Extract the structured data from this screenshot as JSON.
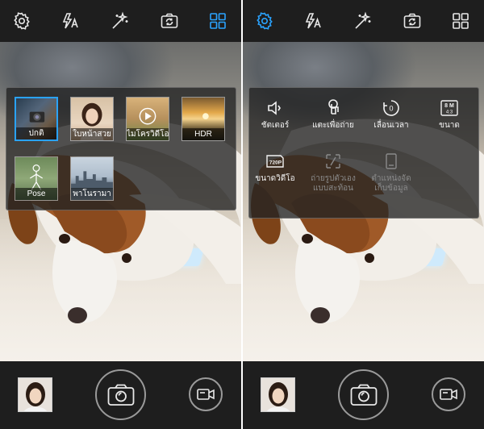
{
  "colors": {
    "accent": "#2aa3ff",
    "icon": "#e8e8e8",
    "disabled": "#8a8a8a"
  },
  "top_icons": [
    "settings-gear-icon",
    "flash-auto-icon",
    "magic-wand-icon",
    "switch-camera-icon",
    "modes-grid-icon"
  ],
  "left_panel": {
    "modes": [
      {
        "label": "ปกติ",
        "icon": "normal-mode-icon",
        "selected": true
      },
      {
        "label": "ใบหน้าสวย",
        "icon": "beauty-face-icon",
        "selected": false
      },
      {
        "label": "ไมโครวิดีโอ",
        "icon": "micro-video-icon",
        "selected": false
      },
      {
        "label": "HDR",
        "icon": "hdr-icon",
        "selected": false
      },
      {
        "label": "Pose",
        "icon": "pose-icon",
        "selected": false
      },
      {
        "label": "พาโนรามา",
        "icon": "panorama-icon",
        "selected": false
      }
    ]
  },
  "right_panel": {
    "settings": [
      {
        "label": "ชัตเตอร์",
        "icon": "shutter-sound-icon",
        "enabled": true
      },
      {
        "label": "แตะเพื่อถ่าย",
        "icon": "tap-to-shoot-icon",
        "enabled": true
      },
      {
        "label": "เลื่อนเวลา",
        "icon": "timer-icon",
        "enabled": true
      },
      {
        "label": "ขนาด",
        "icon": "image-size-icon",
        "enabled": true
      },
      {
        "label": "ขนาดวิดีโอ",
        "icon": "video-size-icon",
        "enabled": true
      },
      {
        "label": "ถ่ายรูปตัวเอง แบบสะท้อน",
        "icon": "mirror-selfie-icon",
        "enabled": false
      },
      {
        "label": "ตำแหน่งจัด เก็บข้อมูล",
        "icon": "storage-location-icon",
        "enabled": false
      }
    ],
    "image_size_badge": "8 M",
    "image_ratio_badge": "4:3",
    "video_size_badge": "720P",
    "timer_badge": "0"
  },
  "bottom": {
    "gallery_icon": "gallery-thumbnail",
    "shutter_icon": "camera-shutter-icon",
    "video_icon": "video-record-icon"
  }
}
